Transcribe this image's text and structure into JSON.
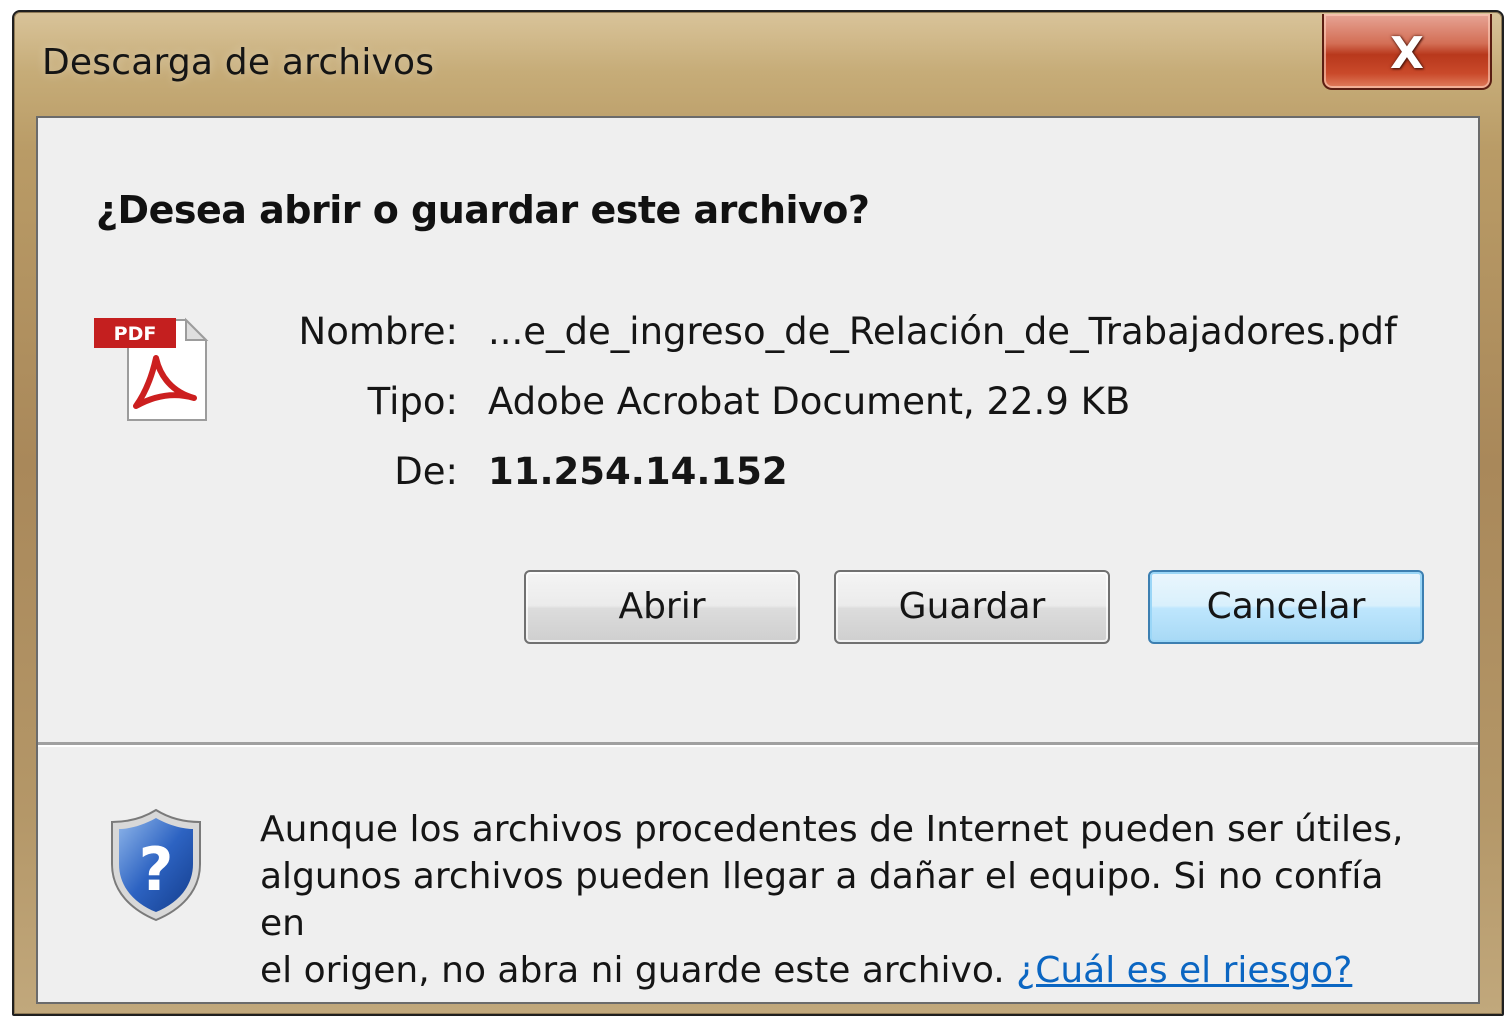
{
  "window": {
    "title": "Descarga de archivos",
    "close_label": "X"
  },
  "dialog": {
    "question": "¿Desea abrir o guardar este archivo?",
    "file_icon": "pdf-icon",
    "file_icon_badge": "PDF",
    "fields": {
      "name_label": "Nombre:",
      "name_value": "...e_de_ingreso_de_Relación_de_Trabajadores.pdf",
      "type_label": "Tipo:",
      "type_value": "Adobe Acrobat Document, 22.9 KB",
      "from_label": "De:",
      "from_value": "11.254.14.152"
    },
    "buttons": {
      "open": "Abrir",
      "save": "Guardar",
      "cancel": "Cancelar"
    }
  },
  "warning": {
    "icon": "shield-question-icon",
    "line1": "Aunque los archivos procedentes de Internet pueden ser útiles,",
    "line2": "algunos archivos pueden llegar a dañar el equipo. Si no confía en",
    "line3": "el origen, no abra ni guarde este archivo. ",
    "link": "¿Cuál es el riesgo?"
  },
  "colors": {
    "titlebar": "#b99b66",
    "client_bg": "#efefef",
    "close_red": "#c9492a",
    "link": "#0b66c2",
    "default_button": "#3c7fb1"
  }
}
